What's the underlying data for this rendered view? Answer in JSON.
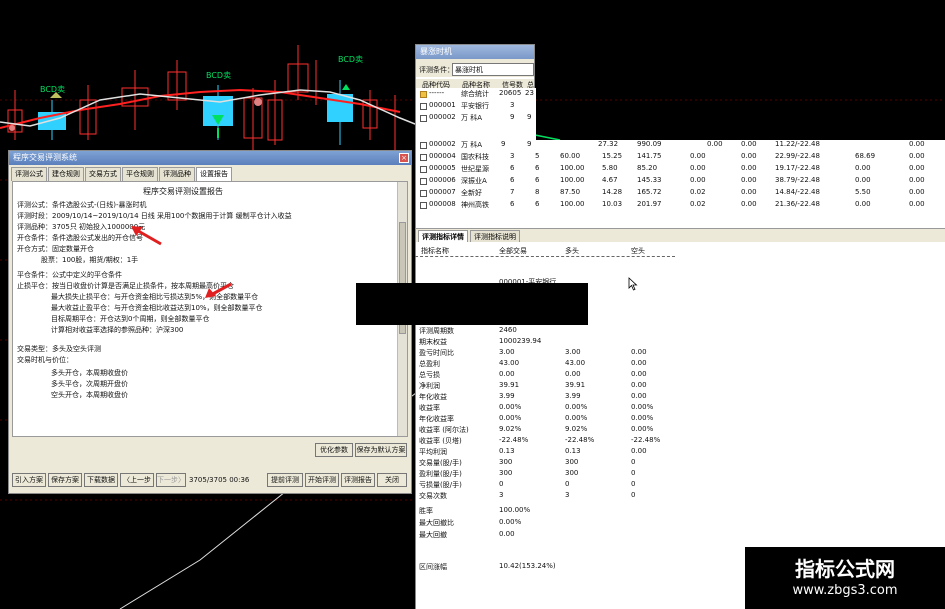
{
  "chart": {
    "labels": [
      "BCD卖",
      "BCD卖",
      "BCD卖"
    ]
  },
  "left_dialog": {
    "title": "程序交易评测系统",
    "tabs": [
      "评测公式",
      "建仓规则",
      "交易方式",
      "平仓规则",
      "评测品种",
      "设置报告"
    ],
    "report_title": "程序交易评测设置报告",
    "lines": [
      "评测公式：条件选股公式-(日线)-暴涨时机",
      "评测时段：2009/10/14~2019/10/14 日线 采用100个数据用于计算 缓制平仓计入收益",
      "评测品种：3705只  初始投入1000000元",
      "开仓条件：条件选股公式发出的开仓信号",
      "开仓方式：固定数量开仓",
      "股票：100股，期货/期权：1手",
      "平仓条件：公式中定义的平仓条件",
      "止损平仓：按当日收盘价计算是否满足止损条件，按本周期最高价平仓",
      "最大损失止损平仓：与开仓资金相比亏损达到5%，则全部数量平仓",
      "最大收益止盈平仓：与开仓资金相比收益达到10%，则全部数量平仓",
      "目标周期平仓：开仓达到0个周期，则全部数量平仓",
      "计算相对收益率选择的参照品种：沪深300",
      "交易类型：多头及空头评测",
      "交易时机与价位：",
      "多头开仓，本周期收盘价",
      "多头平仓，次周期开盘价",
      "空头开仓，本周期收盘价"
    ],
    "buttons_mid": [
      "优化参数",
      "保存为默认方案"
    ],
    "buttons_bottom": [
      "引入方案",
      "保存方案",
      "下载数据",
      "〈上一步",
      "下一步〉",
      "提前评测",
      "开始评测",
      "评测报告",
      "关闭"
    ],
    "progress_text": "3705/3705 00:36"
  },
  "right_window": {
    "title": "暴涨时机",
    "condition_label": "评测条件：",
    "condition_value": "暴涨时机",
    "table_headers": [
      "品种代码",
      "品种名称",
      "信号数",
      "总"
    ],
    "rows": [
      {
        "code": "------",
        "name": "综合统计",
        "n1": "20605",
        "n2": "23",
        "cols": []
      },
      {
        "code": "000001",
        "name": "平安银行",
        "n1": "3",
        "n2": "",
        "cols": []
      },
      {
        "code": "000002",
        "name": "万 科A",
        "n1": "9",
        "n2": "9",
        "cols": [
          "27.32",
          "990.09",
          "0.00",
          "0.00",
          "11.22/-22.48",
          "",
          "0.00"
        ]
      },
      {
        "code": "000004",
        "name": "国农科技",
        "n1": "3",
        "n2": "5",
        "cols": [
          "60.00",
          "15.25",
          "141.75",
          "0.00",
          "0.00",
          "22.99/-22.48",
          "68.69",
          "0.00"
        ]
      },
      {
        "code": "000005",
        "name": "世纪星源",
        "n1": "6",
        "n2": "6",
        "cols": [
          "100.00",
          "5.80",
          "85.20",
          "0.00",
          "0.00",
          "19.17/-22.48",
          "0.00",
          "0.00"
        ]
      },
      {
        "code": "000006",
        "name": "深振业A",
        "n1": "6",
        "n2": "6",
        "cols": [
          "100.00",
          "4.67",
          "145.33",
          "0.00",
          "0.00",
          "38.79/-22.48",
          "0.00",
          "0.00"
        ]
      },
      {
        "code": "000007",
        "name": "全新好",
        "n1": "7",
        "n2": "8",
        "cols": [
          "87.50",
          "14.28",
          "165.72",
          "0.02",
          "0.00",
          "14.84/-22.48",
          "5.50",
          "0.00"
        ]
      },
      {
        "code": "000008",
        "name": "神州高铁",
        "n1": "6",
        "n2": "6",
        "cols": [
          "100.00",
          "10.03",
          "201.97",
          "0.02",
          "0.00",
          "21.36/-22.48",
          "0.00",
          "0.00"
        ]
      }
    ],
    "tabs": [
      "评测指标详情",
      "评测指标说明"
    ],
    "metrics_headers": [
      "指标名称",
      "全部交易",
      "多头",
      "空头"
    ],
    "metrics_subtitle": "000001-平安银行",
    "metrics": [
      {
        "name": "评测周期数",
        "all": "2460",
        "long": "",
        "short": ""
      },
      {
        "name": "期末权益",
        "all": "1000239.94",
        "long": "",
        "short": ""
      },
      {
        "name": "盈亏时间比",
        "all": "3.00",
        "long": "3.00",
        "short": "0.00"
      },
      {
        "name": "总盈利",
        "all": "43.00",
        "long": "43.00",
        "short": "0.00"
      },
      {
        "name": "总亏损",
        "all": "0.00",
        "long": "0.00",
        "short": "0.00"
      },
      {
        "name": "净利润",
        "all": "39.91",
        "long": "39.91",
        "short": "0.00"
      },
      {
        "name": "年化收益",
        "all": "3.99",
        "long": "3.99",
        "short": "0.00"
      },
      {
        "name": "收益率",
        "all": "0.00%",
        "long": "0.00%",
        "short": "0.00%"
      },
      {
        "name": "年化收益率",
        "all": "0.00%",
        "long": "0.00%",
        "short": "0.00%"
      },
      {
        "name": "收益率 (阿尔法)",
        "all": "9.02%",
        "long": "9.02%",
        "short": "0.00%"
      },
      {
        "name": "收益率 (贝塔)",
        "all": "-22.48%",
        "long": "-22.48%",
        "short": "-22.48%"
      },
      {
        "name": "平均利润",
        "all": "0.13",
        "long": "0.13",
        "short": "0.00"
      },
      {
        "name": "交易量(股/手)",
        "all": "300",
        "long": "300",
        "short": "0"
      },
      {
        "name": "盈利量(股/手)",
        "all": "300",
        "long": "300",
        "short": "0"
      },
      {
        "name": "亏损量(股/手)",
        "all": "0",
        "long": "0",
        "short": "0"
      },
      {
        "name": "交易次数",
        "all": "3",
        "long": "3",
        "short": "0"
      },
      {
        "name": "胜率",
        "all": "100.00%",
        "long": "",
        "short": ""
      },
      {
        "name": "最大回撤比",
        "all": "0.00%",
        "long": "",
        "short": ""
      },
      {
        "name": "最大回撤",
        "all": "0.00",
        "long": "",
        "short": ""
      },
      {
        "name": "区间涨幅",
        "all": "10.42(153.24%)",
        "long": "",
        "short": ""
      }
    ]
  },
  "watermark": {
    "title": "指标公式网",
    "url": "www.zbgs3.com"
  },
  "colors": {
    "titlebar": "#5b7fbc",
    "dialog_bg": "#ece9d8",
    "candle_up": "#ff3030",
    "candle_down": "#30d0ff",
    "signal_green": "#00e060",
    "arrow_red": "#e02020"
  }
}
